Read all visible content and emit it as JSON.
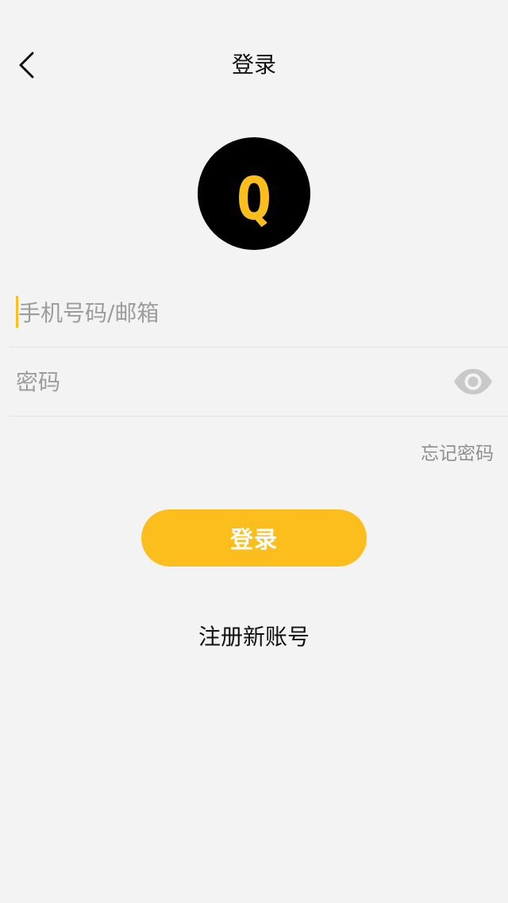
{
  "header": {
    "title": "登录",
    "back_icon": "chevron-left-icon"
  },
  "logo": {
    "letter": "Q",
    "background_color": "#000000",
    "letter_color": "#fcbe1c"
  },
  "form": {
    "account": {
      "value": "",
      "placeholder": "手机号码/邮箱"
    },
    "password": {
      "value": "",
      "placeholder": "密码",
      "toggle_icon": "eye-icon"
    },
    "forgot_label": "忘记密码",
    "submit_label": "登录",
    "register_label": "注册新账号"
  },
  "colors": {
    "accent": "#fcbe1c",
    "background": "#f3f3f3",
    "placeholder": "#9c9c9c",
    "divider": "#e4e4e4"
  }
}
